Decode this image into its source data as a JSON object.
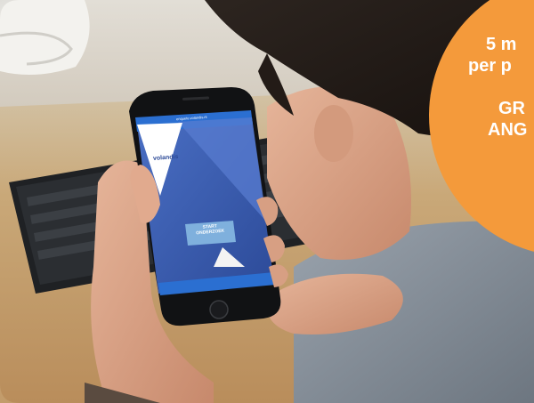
{
  "badge": {
    "line1": "5 m",
    "line2": "per p",
    "line3": "GR",
    "line4": "ANG",
    "color": "#f49a3b"
  },
  "phone": {
    "url": "enquete.volandis.nl",
    "brand": "volandis",
    "start_button": "START\nONDERZOEK",
    "screen_color": "#3b5fb0"
  }
}
